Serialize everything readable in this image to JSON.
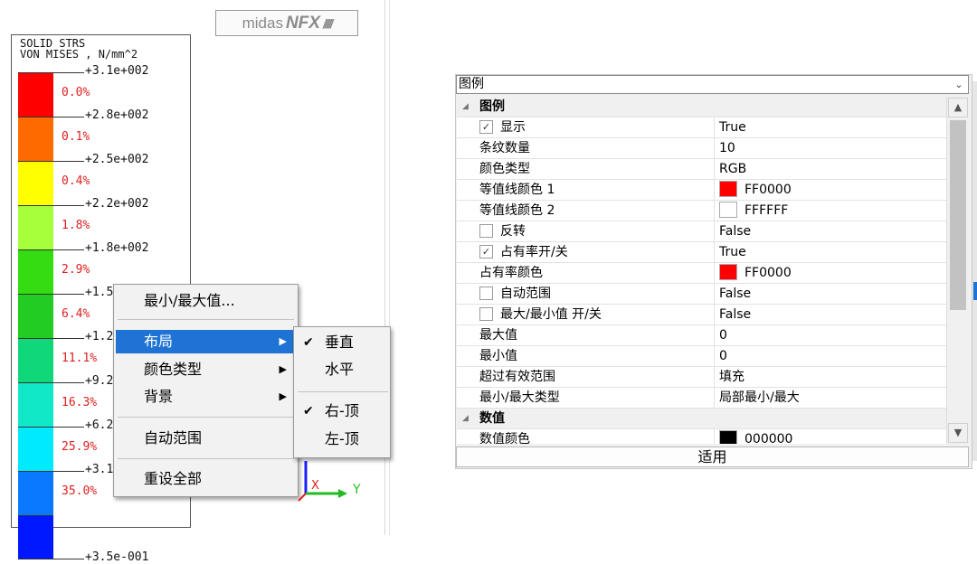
{
  "logo": {
    "part1": "midas",
    "part2": "NFX",
    "stripes": "/////"
  },
  "legend": {
    "title_line1": "SOLID STRS",
    "title_line2": "VON MISES , N/mm^2",
    "band_colors": [
      "#ff0000",
      "#ff6a00",
      "#ffff00",
      "#a6ff3a",
      "#33dd11",
      "#22cc22",
      "#10d878",
      "#11e8c8",
      "#00eaff",
      "#0a78ff",
      "#0018ff"
    ],
    "tick_labels": [
      "+3.1e+002",
      "+2.8e+002",
      "+2.5e+002",
      "+2.2e+002",
      "+1.8e+002",
      "+1.5",
      "+1.2",
      "+9.2",
      "+6.2",
      "+3.1",
      "+3.5e-001"
    ],
    "percent_labels": [
      "0.0%",
      "0.1%",
      "0.4%",
      "1.8%",
      "2.9%",
      "6.4%",
      "11.1%",
      "16.3%",
      "25.9%",
      "35.0%"
    ]
  },
  "context_menu": {
    "items": [
      {
        "label": "最小/最大值...",
        "has_submenu": false
      },
      {
        "label": "布局",
        "has_submenu": true,
        "highlighted": true
      },
      {
        "label": "颜色类型",
        "has_submenu": true
      },
      {
        "label": "背景",
        "has_submenu": true
      },
      {
        "label": "自动范围",
        "has_submenu": false
      },
      {
        "label": "重设全部",
        "has_submenu": false
      }
    ],
    "submenu": [
      {
        "label": "垂直",
        "checked": true
      },
      {
        "label": "水平",
        "checked": false
      },
      {
        "label": "右-顶",
        "checked": true
      },
      {
        "label": "左-顶",
        "checked": false
      }
    ]
  },
  "axes": {
    "x_label": "X",
    "y_label": "Y"
  },
  "property_panel": {
    "selector_value": "图例",
    "rows": [
      {
        "type": "category",
        "name": "图例"
      },
      {
        "name": "显示",
        "value": "True",
        "checkbox": true,
        "checked": true
      },
      {
        "name": "条纹数量",
        "value": "10"
      },
      {
        "name": "颜色类型",
        "value": "RGB"
      },
      {
        "name": "等值线颜色 1",
        "value": "FF0000",
        "swatch": "#ff0000"
      },
      {
        "name": "等值线颜色 2",
        "value": "FFFFFF",
        "swatch": "#ffffff"
      },
      {
        "name": "反转",
        "value": "False",
        "checkbox": true,
        "checked": false
      },
      {
        "name": "占有率开/关",
        "value": "True",
        "checkbox": true,
        "checked": true
      },
      {
        "name": "占有率颜色",
        "value": "FF0000",
        "swatch": "#ff0000"
      },
      {
        "name": "自动范围",
        "value": "False",
        "checkbox": true,
        "checked": false
      },
      {
        "name": "最大/最小值 开/关",
        "value": "False",
        "checkbox": true,
        "checked": false
      },
      {
        "name": "最大值",
        "value": "0"
      },
      {
        "name": "最小值",
        "value": "0"
      },
      {
        "name": "超过有效范围",
        "value": "填充"
      },
      {
        "name": "最小/最大类型",
        "value": "局部最小/最大"
      },
      {
        "type": "category",
        "name": "数值"
      },
      {
        "name": "数值颜色",
        "value": "000000",
        "swatch": "#000000"
      }
    ],
    "apply_label": "适用",
    "colors": {
      "highlight": "#1e73d4",
      "checkmark": "#333333"
    }
  }
}
